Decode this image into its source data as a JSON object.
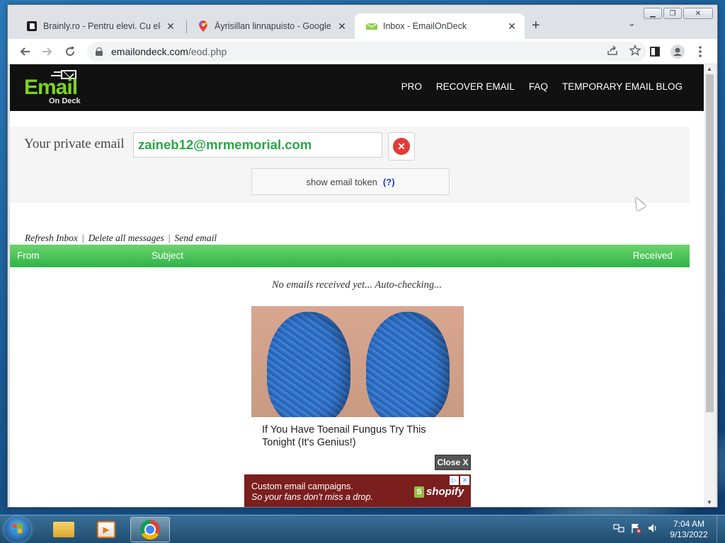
{
  "browser": {
    "tabs": [
      {
        "title": "Brainly.ro - Pentru elevi. Cu elevi.",
        "favicon": "brainly-icon",
        "active": false
      },
      {
        "title": "Äyrisillan linnapuisto - Google Ma",
        "favicon": "google-maps-icon",
        "active": false
      },
      {
        "title": "Inbox - EmailOnDeck",
        "favicon": "emailondeck-icon",
        "active": true
      }
    ],
    "url_host": "emailondeck.com",
    "url_path": "/eod.php"
  },
  "site": {
    "logo_email": "Email",
    "logo_ondeck": "On Deck",
    "nav": [
      "PRO",
      "RECOVER EMAIL",
      "FAQ",
      "TEMPORARY EMAIL BLOG"
    ]
  },
  "email_panel": {
    "label": "Your private email",
    "address": "zaineb12@mrmemorial.com",
    "token_label": "show email token",
    "token_help": "(?)"
  },
  "inbox": {
    "actions": [
      "Refresh Inbox",
      "Delete all messages",
      "Send email"
    ],
    "columns": {
      "from": "From",
      "subject": "Subject",
      "received": "Received"
    },
    "empty_message": "No emails received yet... Auto-checking..."
  },
  "ad": {
    "headline": "If You Have Toenail Fungus Try This Tonight (It's Genius!)",
    "close_label": "Close X"
  },
  "banner": {
    "line1": "Custom email campaigns.",
    "line2": "So your fans don't miss a drop.",
    "brand": "shopify"
  },
  "taskbar": {
    "time": "7:04 AM",
    "date": "9/13/2022"
  },
  "colors": {
    "brand_green": "#7ed321",
    "email_green": "#28a745",
    "inbox_header": "#2fb34a",
    "clear_red": "#e53935"
  }
}
